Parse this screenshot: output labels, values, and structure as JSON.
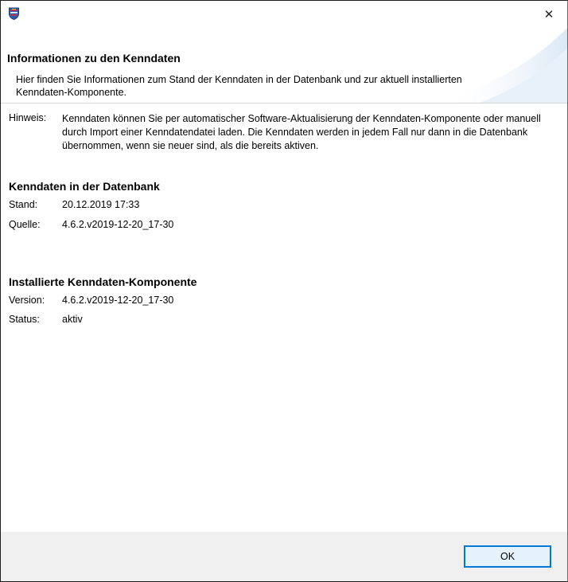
{
  "window": {
    "icon": "hessen-coat-of-arms-icon",
    "close_glyph": "✕"
  },
  "banner": {
    "title": "Informationen zu den Kenndaten",
    "description": "Hier finden Sie Informationen zum Stand der Kenndaten in der Datenbank und zur aktuell installierten Kenndaten-Komponente."
  },
  "hint": {
    "label": "Hinweis:",
    "text": "Kenndaten können Sie per automatischer Software-Aktualisierung der Kenndaten-Komponente oder manuell durch Import einer Kenndatendatei laden. Die Kenndaten werden in jedem Fall nur dann in die Datenbank übernommen, wenn sie neuer sind, als die bereits aktiven."
  },
  "database": {
    "title": "Kenndaten in der Datenbank",
    "stand_label": "Stand:",
    "stand_value": "20.12.2019 17:33",
    "quelle_label": "Quelle:",
    "quelle_value": "4.6.2.v2019-12-20_17-30"
  },
  "component": {
    "title": "Installierte Kenndaten-Komponente",
    "version_label": "Version:",
    "version_value": "4.6.2.v2019-12-20_17-30",
    "status_label": "Status:",
    "status_value": "aktiv"
  },
  "footer": {
    "ok_label": "OK"
  },
  "colors": {
    "accent": "#0078d7",
    "footer_bg": "#f0f0f0"
  }
}
